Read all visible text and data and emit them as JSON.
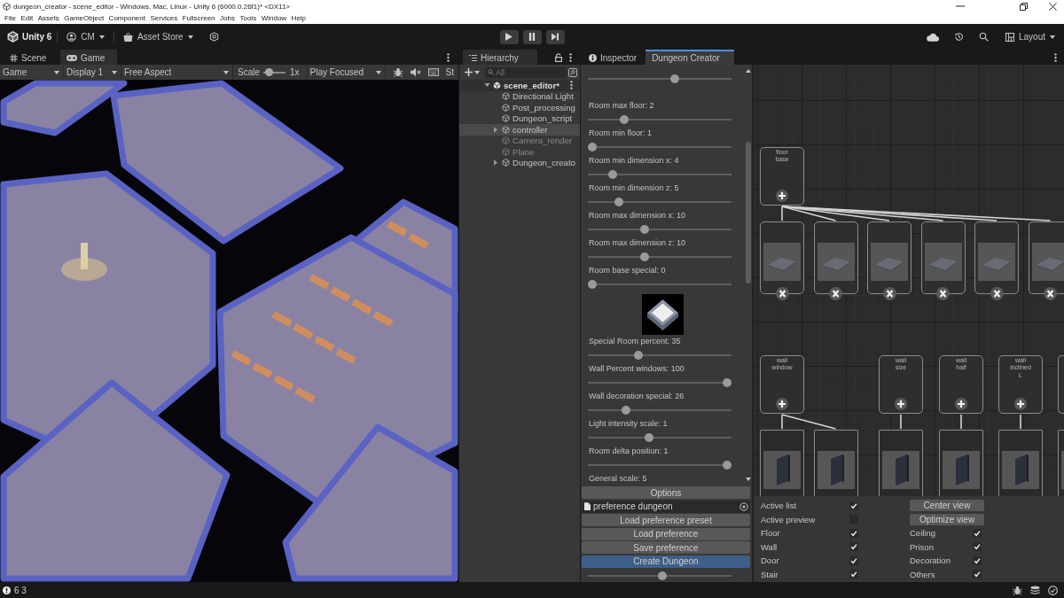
{
  "window": {
    "title": "dungeon_creator - scene_editor - Windows, Mac, Linux - Unity 6 (6000.0.26f1)* <DX11>"
  },
  "menu": [
    "File",
    "Edit",
    "Assets",
    "GameObject",
    "Component",
    "Services",
    "Fullscreen",
    "Jobs",
    "Tools",
    "Window",
    "Help"
  ],
  "toolbar": {
    "product": "Unity 6",
    "account": "CM",
    "store": "Asset Store",
    "layout": "Layout",
    "play_controls": [
      {
        "kind": "play"
      },
      {
        "kind": "pause"
      },
      {
        "kind": "step"
      }
    ]
  },
  "game_panel": {
    "tabs": [
      {
        "label": "Scene",
        "kind": "scene",
        "selected": false
      },
      {
        "label": "Game",
        "kind": "game",
        "selected": true
      }
    ],
    "view": "Game",
    "display": "Display 1",
    "aspect": "Free Aspect",
    "scale_label": "Scale",
    "scale": {
      "level": 0.1
    },
    "scale_value": "1x",
    "play_mode": "Play Focused",
    "cut_label": "St"
  },
  "hierarchy": {
    "tab": "Hierarchy",
    "search": {
      "placeholder": "All"
    },
    "tree": [
      {
        "label": "scene_editor*",
        "kind": "scene",
        "expanded": true,
        "selected": false,
        "disabled": false,
        "children": [
          {
            "label": "Directional Light",
            "kind": "object",
            "selected": false,
            "disabled": false
          },
          {
            "label": "Post_processing",
            "kind": "object",
            "selected": false,
            "disabled": false
          },
          {
            "label": "Dungeon_script",
            "kind": "object",
            "selected": false,
            "disabled": false
          },
          {
            "label": "controller",
            "kind": "object",
            "expanded": false,
            "selected": true,
            "disabled": false
          },
          {
            "label": "Camera_render",
            "kind": "object",
            "selected": false,
            "disabled": true
          },
          {
            "label": "Plane",
            "kind": "object",
            "selected": false,
            "disabled": true
          },
          {
            "label": "Dungeon_creato",
            "kind": "object",
            "expanded": false,
            "selected": false,
            "disabled": false
          }
        ]
      }
    ]
  },
  "dock_tabs": [
    {
      "label": "Inspector",
      "kind": "info",
      "selected": false,
      "focused": false
    },
    {
      "label": "Dungeon Creator",
      "kind": "plain",
      "selected": true,
      "focused": true
    }
  ],
  "creator": {
    "settings": [
      {
        "kind": "slider",
        "level": 0.61
      },
      {
        "kind": "slider",
        "label": "Room max floor: 2",
        "level": 0.24
      },
      {
        "kind": "slider",
        "label": "Room min floor: 1",
        "level": 0
      },
      {
        "kind": "slider",
        "label": "Room min dimension x: 4",
        "level": 0.15
      },
      {
        "kind": "slider",
        "label": "Room min dimension z: 5",
        "level": 0.2
      },
      {
        "kind": "slider",
        "label": "Room max dimension x: 10",
        "level": 0.39
      },
      {
        "kind": "slider",
        "label": "Room max dimension z: 10",
        "level": 0.39
      },
      {
        "kind": "slider",
        "label": "Room base special: 0",
        "level": 0
      },
      {
        "kind": "preview"
      },
      {
        "kind": "slider",
        "label": "Special Room percent: 35",
        "level": 0.34
      },
      {
        "kind": "slider",
        "label": "Wall Percent windows: 100",
        "level": 1
      },
      {
        "kind": "slider",
        "label": "Wall decoration special: 26",
        "level": 0.25
      },
      {
        "kind": "slider",
        "label": "Light intensity scale: 1",
        "level": 0.42
      },
      {
        "kind": "slider",
        "label": "Room delta position: 1",
        "level": 1
      },
      {
        "kind": "slider",
        "label": "General scale: 5"
      }
    ],
    "options_button": "Options",
    "preset_field": {
      "value": "preference dungeon"
    },
    "buttons": [
      {
        "label": "Load preference preset",
        "kind": "normal"
      },
      {
        "label": "Load preference",
        "kind": "normal"
      },
      {
        "label": "Save preference",
        "kind": "normal"
      },
      {
        "label": "Create Dungeon",
        "kind": "primary"
      }
    ],
    "footer_slider": {
      "level": 0.52
    }
  },
  "graph": {
    "rows": [
      {
        "parents": [
          {
            "label": "floor base",
            "children": [
              {
                "kind": "floor"
              },
              {
                "kind": "floor"
              },
              {
                "kind": "floor"
              },
              {
                "kind": "floor"
              },
              {
                "kind": "floor"
              },
              {
                "kind": "floor"
              }
            ]
          }
        ]
      },
      {
        "parents": [
          {
            "label": "wall window",
            "children": [
              {
                "kind": "wall"
              },
              {
                "kind": "wall"
              }
            ]
          },
          {
            "label": "wall size",
            "children": [
              {
                "kind": "wall"
              }
            ]
          },
          {
            "label": "wall half",
            "children": [
              {
                "kind": "wall"
              }
            ]
          },
          {
            "label": "wall inclined L",
            "children": [
              {
                "kind": "wall"
              }
            ]
          },
          {
            "children": [
              {
                "kind": "wall"
              }
            ]
          }
        ]
      }
    ]
  },
  "graph_options": {
    "left": [
      {
        "label": "Active list",
        "checked": true
      },
      {
        "label": "Active preview",
        "checked": false
      },
      {
        "label": "Floor",
        "checked": true
      },
      {
        "label": "Wall",
        "checked": true
      },
      {
        "label": "Door",
        "checked": true
      },
      {
        "label": "Stair",
        "checked": true
      }
    ],
    "buttons": [
      "Center view",
      "Optimize view"
    ],
    "right": [
      {
        "label": "Ceiling",
        "checked": true
      },
      {
        "label": "Prison",
        "checked": true
      },
      {
        "label": "Decoration",
        "checked": true
      },
      {
        "label": "Others",
        "checked": true
      }
    ]
  },
  "status_bar": {
    "counts": "6 3"
  }
}
